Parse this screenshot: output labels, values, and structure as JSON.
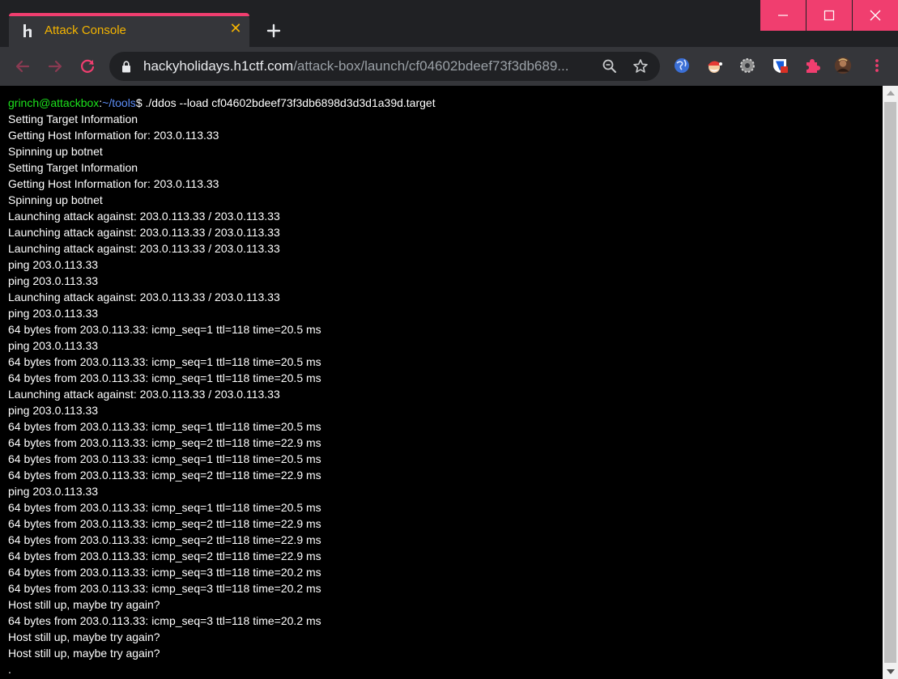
{
  "browser": {
    "tab": {
      "title": "Attack Console",
      "close_glyph": "✕",
      "favicon": "h1-logo-icon"
    },
    "new_tab_icon": "plus-icon",
    "window_controls": [
      "minimize-icon",
      "maximize-icon",
      "close-icon"
    ],
    "address_bar": {
      "host": "hackyholidays.h1ctf.com",
      "path": "/attack-box/launch/cf04602bdeef73f3db689..."
    },
    "extensions": [
      "globe-extension-icon",
      "santa-extension-icon",
      "gear-extension-icon",
      "shield-extension-icon",
      "puzzle-extension-icon",
      "profile-avatar",
      "menu-dots-icon"
    ]
  },
  "colors": {
    "accent": "#f03e6f",
    "tab_title": "#f4b400",
    "prompt_user": "#1ce21c",
    "prompt_path": "#5c8df6",
    "terminal_bg": "#000000",
    "terminal_text": "#ffffff"
  },
  "terminal": {
    "prompt": {
      "user": "grinch@attackbox",
      "sep": ":",
      "path": "~/tools",
      "symbol": "$",
      "command": " ./ddos --load cf04602bdeef73f3db6898d3d3d1a39d.target"
    },
    "lines": [
      "Setting Target Information",
      "Getting Host Information for: 203.0.113.33",
      "Spinning up botnet",
      "Setting Target Information",
      "Getting Host Information for: 203.0.113.33",
      "Spinning up botnet",
      "Launching attack against: 203.0.113.33 / 203.0.113.33",
      "Launching attack against: 203.0.113.33 / 203.0.113.33",
      "Launching attack against: 203.0.113.33 / 203.0.113.33",
      "ping 203.0.113.33",
      "ping 203.0.113.33",
      "Launching attack against: 203.0.113.33 / 203.0.113.33",
      "ping 203.0.113.33",
      "64 bytes from 203.0.113.33: icmp_seq=1 ttl=118 time=20.5 ms",
      "ping 203.0.113.33",
      "64 bytes from 203.0.113.33: icmp_seq=1 ttl=118 time=20.5 ms",
      "64 bytes from 203.0.113.33: icmp_seq=1 ttl=118 time=20.5 ms",
      "Launching attack against: 203.0.113.33 / 203.0.113.33",
      "ping 203.0.113.33",
      "64 bytes from 203.0.113.33: icmp_seq=1 ttl=118 time=20.5 ms",
      "64 bytes from 203.0.113.33: icmp_seq=2 ttl=118 time=22.9 ms",
      "64 bytes from 203.0.113.33: icmp_seq=1 ttl=118 time=20.5 ms",
      "64 bytes from 203.0.113.33: icmp_seq=2 ttl=118 time=22.9 ms",
      "ping 203.0.113.33",
      "64 bytes from 203.0.113.33: icmp_seq=1 ttl=118 time=20.5 ms",
      "64 bytes from 203.0.113.33: icmp_seq=2 ttl=118 time=22.9 ms",
      "64 bytes from 203.0.113.33: icmp_seq=2 ttl=118 time=22.9 ms",
      "64 bytes from 203.0.113.33: icmp_seq=2 ttl=118 time=22.9 ms",
      "64 bytes from 203.0.113.33: icmp_seq=3 ttl=118 time=20.2 ms",
      "64 bytes from 203.0.113.33: icmp_seq=3 ttl=118 time=20.2 ms",
      "Host still up, maybe try again?",
      "64 bytes from 203.0.113.33: icmp_seq=3 ttl=118 time=20.2 ms",
      "Host still up, maybe try again?",
      "Host still up, maybe try again?",
      "."
    ]
  }
}
